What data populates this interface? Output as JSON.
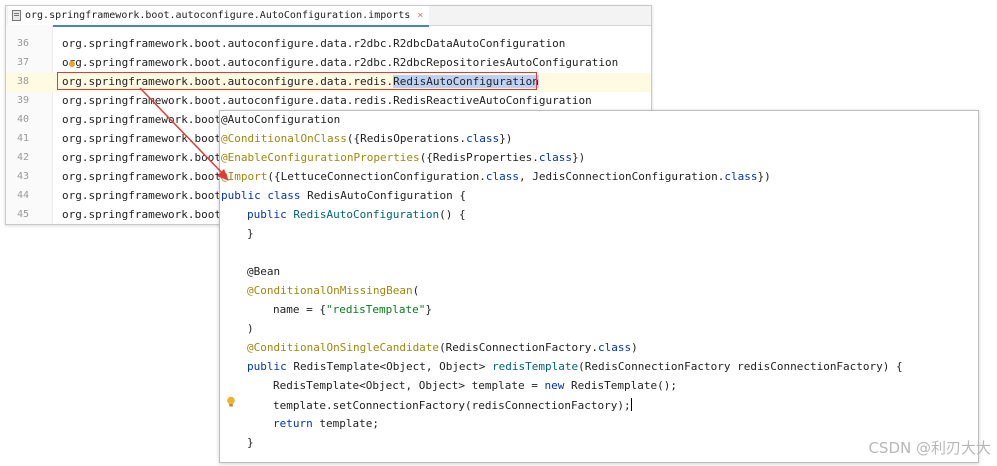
{
  "editor_tab": {
    "filename": "org.springframework.boot.autoconfigure.AutoConfiguration.imports",
    "close_glyph": "×"
  },
  "imports_lines": [
    {
      "num": "36",
      "text": "org.springframework.boot.autoconfigure.data.r2dbc.R2dbcDataAutoConfiguration"
    },
    {
      "num": "37",
      "text": "org.springframework.boot.autoconfigure.data.r2dbc.R2dbcRepositoriesAutoConfiguration"
    },
    {
      "num": "38",
      "prefix": "org.springframework.boot.autoconfigure.data.redis.",
      "highlight": "RedisAutoConfiguration"
    },
    {
      "num": "39",
      "text": "org.springframework.boot.autoconfigure.data.redis.RedisReactiveAutoConfiguration"
    },
    {
      "num": "40",
      "text": "org.springframework.boot"
    },
    {
      "num": "41",
      "text": "org.springframework.boot"
    },
    {
      "num": "42",
      "text": "org.springframework.boot"
    },
    {
      "num": "43",
      "text": "org.springframework.boot"
    },
    {
      "num": "44",
      "text": "org.springframework.boot"
    },
    {
      "num": "45",
      "text": "org.springframework.boot."
    }
  ],
  "popup_code": {
    "l1": "@AutoConfiguration",
    "l2_ann": "@ConditionalOnClass",
    "l2_a": "({RedisOperations.",
    "l2_kw": "class",
    "l2_b": "})",
    "l3_ann": "@EnableConfigurationProperties",
    "l3_a": "({RedisProperties.",
    "l3_kw": "class",
    "l3_b": "})",
    "l4_ann": "@Import",
    "l4_a": "({LettuceConnectionConfiguration.",
    "l4_kw1": "class",
    "l4_b": ", JedisConnectionConfiguration.",
    "l4_kw2": "class",
    "l4_c": "})",
    "l5_kw": "public class",
    "l5_a": " RedisAutoConfiguration {",
    "l6_kw": "public",
    "l6_m": "RedisAutoConfiguration",
    "l6_a": "() {",
    "l7": "}",
    "l8": "@Bean",
    "l9_ann": "@ConditionalOnMissingBean",
    "l9_a": "(",
    "l10_a": "name = {",
    "l10_str": "\"redisTemplate\"",
    "l10_b": "}",
    "l11": ")",
    "l12_ann": "@ConditionalOnSingleCandidate",
    "l12_a": "(RedisConnectionFactory.",
    "l12_kw": "class",
    "l12_b": ")",
    "l13_kw": "public",
    "l13_a": " RedisTemplate<Object, Object> ",
    "l13_m": "redisTemplate",
    "l13_b": "(RedisConnectionFactory redisConnectionFactory) {",
    "l14_a": "RedisTemplate<Object, Object> template = ",
    "l14_kw": "new",
    "l14_b": " RedisTemplate();",
    "l15": "template.setConnectionFactory(redisConnectionFactory);",
    "l16_kw": "return",
    "l16_a": " template;",
    "l17": "}"
  },
  "watermark": "CSDN @利刃大大",
  "colors": {
    "annotation": "#9e880d",
    "keyword": "#0033b3",
    "string": "#067d17",
    "highlight_box": "#e03b3b",
    "selection": "#bcd2f5"
  }
}
